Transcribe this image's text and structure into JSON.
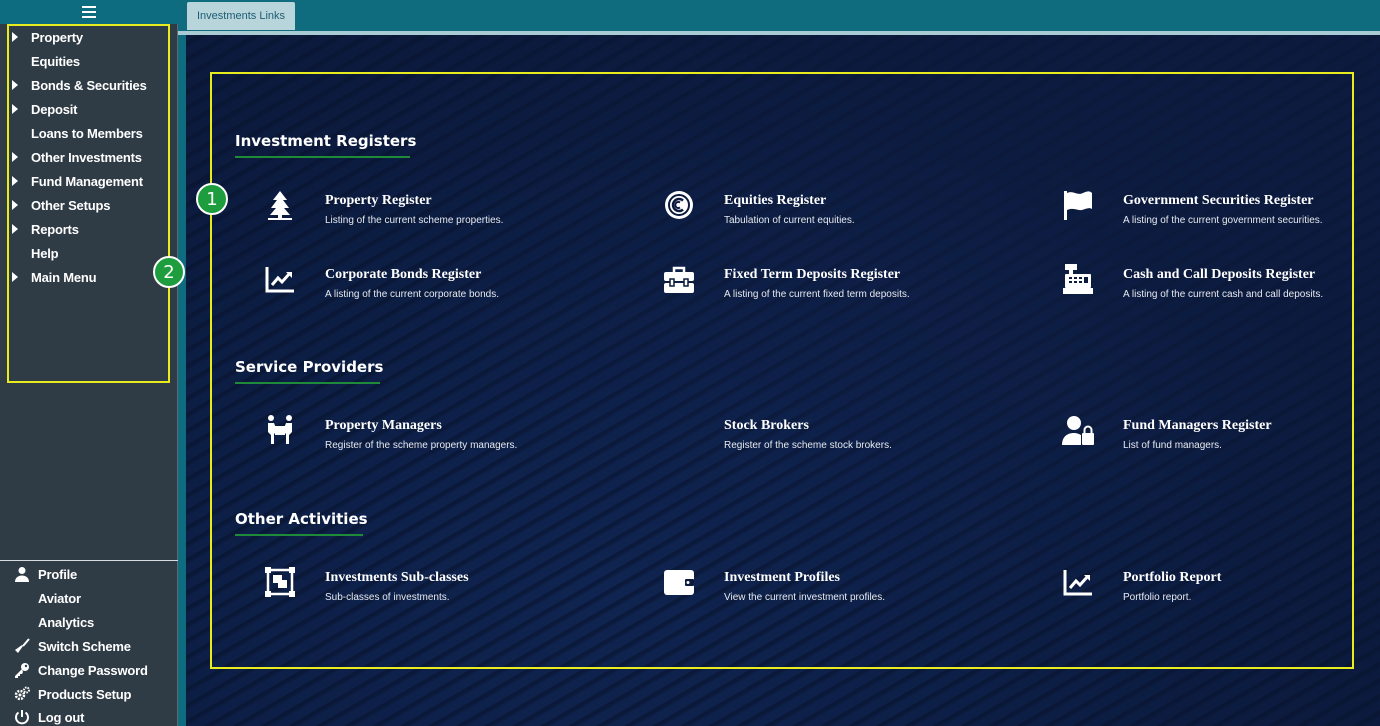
{
  "sidebar": {
    "nav_items": [
      {
        "label": "Property",
        "expandable": true
      },
      {
        "label": "Equities",
        "expandable": false
      },
      {
        "label": "Bonds & Securities",
        "expandable": true
      },
      {
        "label": "Deposit",
        "expandable": true
      },
      {
        "label": "Loans to Members",
        "expandable": false
      },
      {
        "label": "Other Investments",
        "expandable": true
      },
      {
        "label": "Fund Management",
        "expandable": true
      },
      {
        "label": "Other Setups",
        "expandable": true
      },
      {
        "label": "Reports",
        "expandable": true
      },
      {
        "label": "Help",
        "expandable": false
      },
      {
        "label": "Main Menu",
        "expandable": true
      }
    ],
    "bottom_items": [
      {
        "label": "Profile",
        "icon": "user-icon"
      },
      {
        "label": "Aviator",
        "icon": ""
      },
      {
        "label": "Analytics",
        "icon": ""
      },
      {
        "label": "Switch Scheme",
        "icon": "broom-icon"
      },
      {
        "label": "Change Password",
        "icon": "key-icon"
      },
      {
        "label": "Products Setup",
        "icon": "cogs-icon"
      },
      {
        "label": "Log out",
        "icon": "power-icon"
      }
    ]
  },
  "badges": {
    "one": "1",
    "two": "2"
  },
  "tabs": {
    "active": "Investments Links"
  },
  "sections": {
    "registers": {
      "title": "Investment Registers",
      "cards": [
        {
          "title": "Property Register",
          "desc": "Listing of the current scheme properties.",
          "icon": "tree-icon"
        },
        {
          "title": "Equities Register",
          "desc": "Tabulation of current equities.",
          "icon": "copyright-icon"
        },
        {
          "title": "Government Securities Register",
          "desc": "A listing of the current government securities.",
          "icon": "flag-icon"
        },
        {
          "title": "Corporate Bonds Register",
          "desc": "A listing of the current corporate bonds.",
          "icon": "line-chart-icon"
        },
        {
          "title": "Fixed Term Deposits Register",
          "desc": "A listing of the current fixed term deposits.",
          "icon": "toolbox-icon"
        },
        {
          "title": "Cash and Call Deposits Register",
          "desc": "A listing of the current cash and call deposits.",
          "icon": "cash-register-icon"
        }
      ]
    },
    "providers": {
      "title": "Service Providers",
      "cards": [
        {
          "title": "Property Managers",
          "desc": "Register of the scheme property managers.",
          "icon": "people-carry-icon"
        },
        {
          "title": "Stock Brokers",
          "desc": "Register of the scheme stock brokers.",
          "icon": ""
        },
        {
          "title": "Fund Managers Register",
          "desc": "List of fund managers.",
          "icon": "user-lock-icon"
        }
      ]
    },
    "other": {
      "title": "Other Activities",
      "cards": [
        {
          "title": "Investments Sub-classes",
          "desc": "Sub-classes of investments.",
          "icon": "object-group-icon"
        },
        {
          "title": "Investment Profiles",
          "desc": "View the current investment profiles.",
          "icon": "wallet-icon"
        },
        {
          "title": "Portfolio Report",
          "desc": "Portfolio report.",
          "icon": "line-chart-icon"
        }
      ]
    }
  }
}
